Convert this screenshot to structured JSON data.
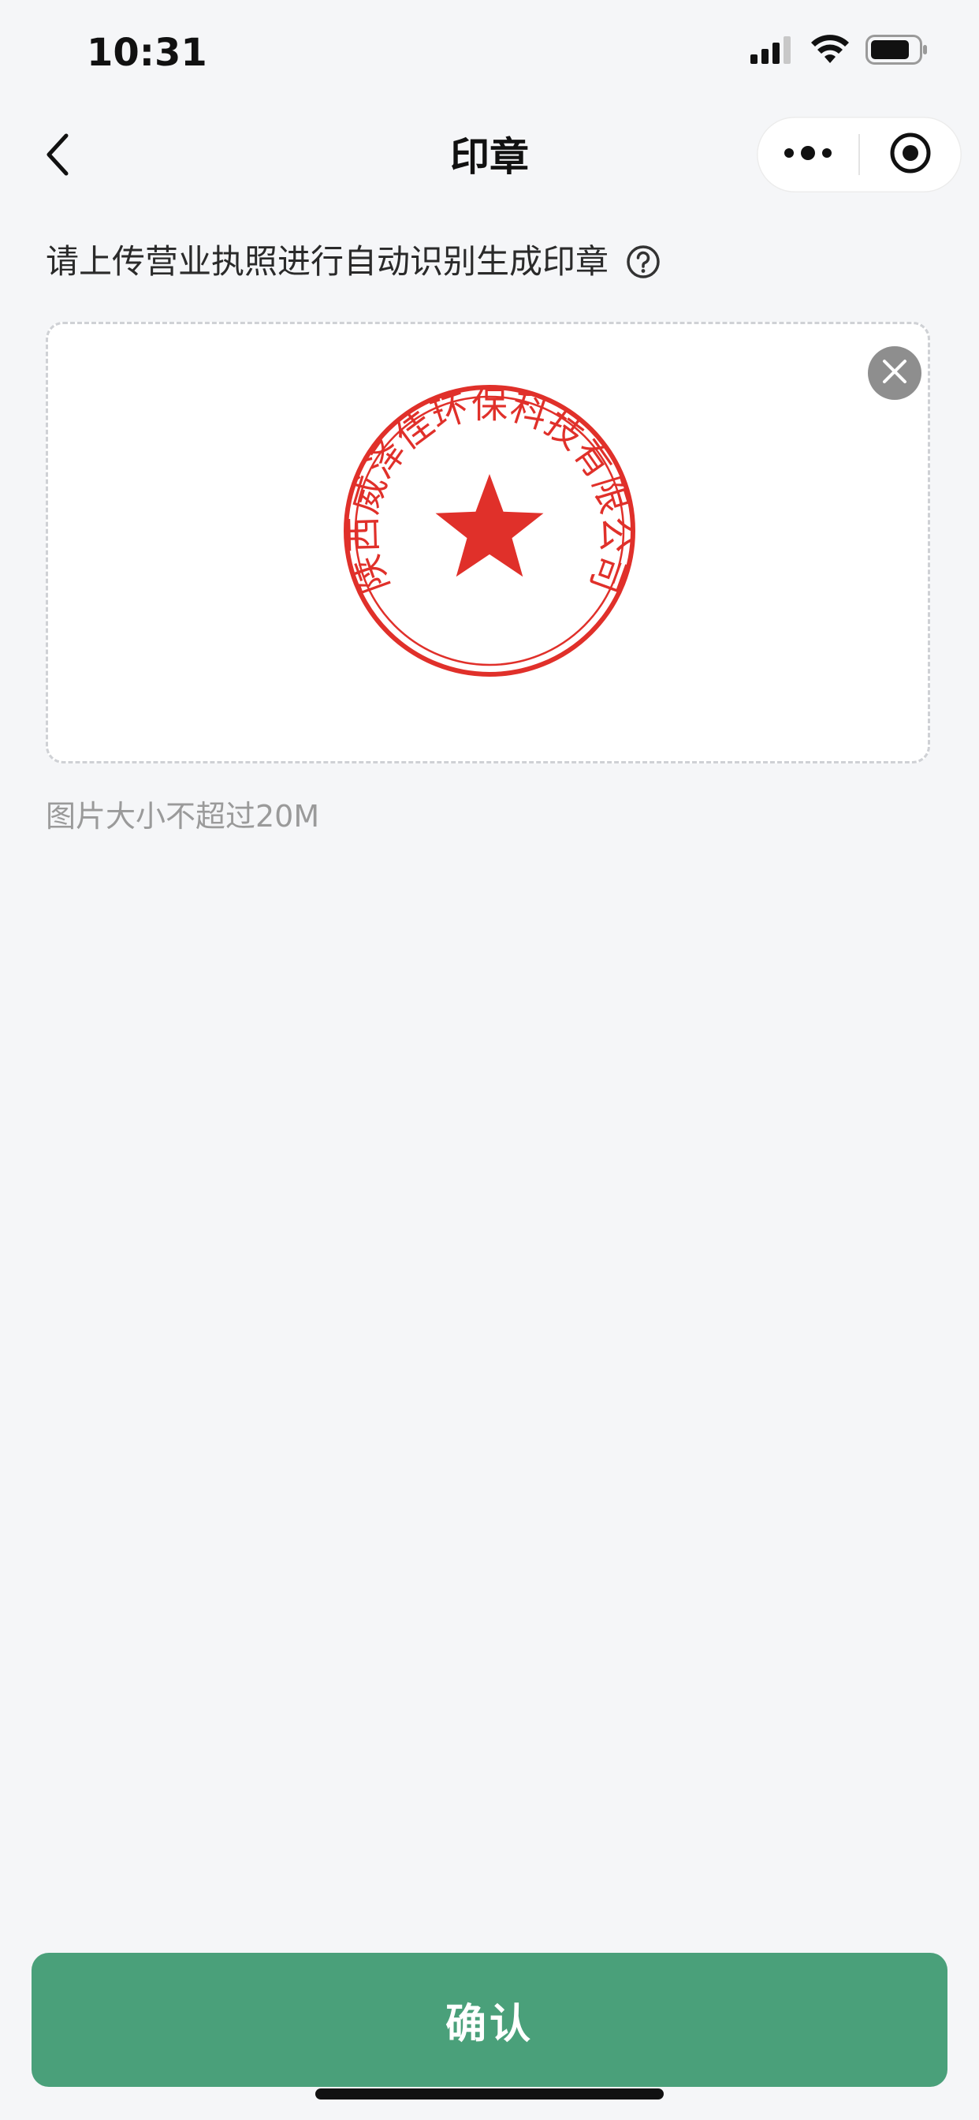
{
  "status_bar": {
    "time": "10:31",
    "signal_icon": "cellular-signal-icon",
    "wifi_icon": "wifi-icon",
    "battery_icon": "battery-icon"
  },
  "nav": {
    "title": "印章",
    "back_icon": "chevron-left-icon",
    "more_icon": "more-dots-icon",
    "close_icon": "target-circle-icon"
  },
  "content": {
    "hint": "请上传营业执照进行自动识别生成印章",
    "help_icon": "question-circle-icon",
    "upload": {
      "seal_text": "陕西威泽佳环保科技有限公司",
      "seal_color": "#e0302a",
      "remove_icon": "close-circle-icon"
    },
    "size_note": "图片大小不超过20M"
  },
  "footer": {
    "confirm_label": "确认",
    "accent": "#4aa07a"
  }
}
